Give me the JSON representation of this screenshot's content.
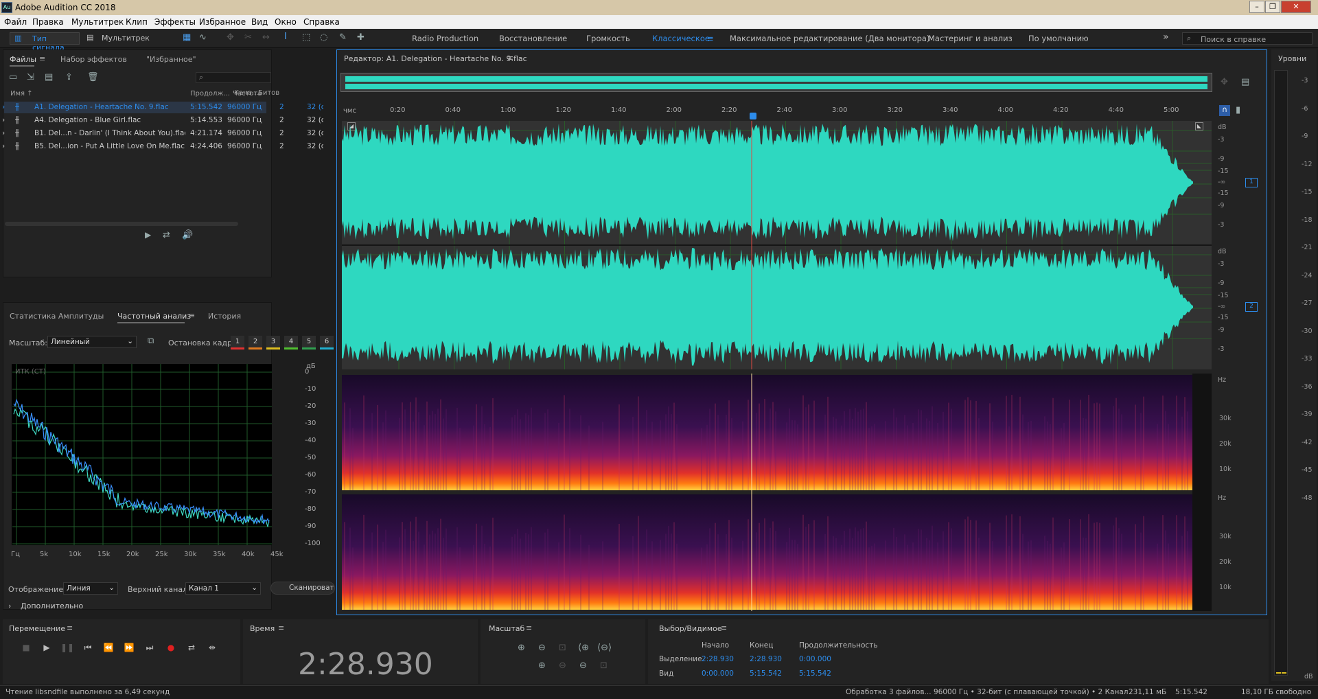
{
  "app": {
    "title": "Adobe Audition CC 2018",
    "icon": "Au"
  },
  "menu": [
    "Файл",
    "Правка",
    "Мультитрек",
    "Клип",
    "Эффекты",
    "Избранное",
    "Вид",
    "Окно",
    "Справка"
  ],
  "toolbar": {
    "mode_waveform": "Тип сигнала",
    "mode_multitrack": "Мультитрек",
    "workspaces": [
      "Radio Production",
      "Восстановление",
      "Громкость",
      "Классическое",
      "Максимальное редактирование (Два монитора)",
      "Мастеринг и анализ",
      "По умолчанию"
    ],
    "active_workspace": "Классическое",
    "more": "»",
    "search_placeholder": "Поиск в справке"
  },
  "files_panel": {
    "tabs": [
      "Файлы",
      "Набор эффектов",
      "\"Избранное\""
    ],
    "search_icon": "⌕",
    "columns": [
      "Имя ↑",
      "Продолж...",
      "Частота",
      "Кана...",
      "Битов"
    ],
    "rows": [
      {
        "name": "A1. Delegation - Heartache No. 9.flac",
        "dur": "5:15.542",
        "rate": "96000 Гц",
        "ch": "2",
        "bits": "32 (с",
        "selected": true
      },
      {
        "name": "A4. Delegation - Blue Girl.flac",
        "dur": "5:14.553",
        "rate": "96000 Гц",
        "ch": "2",
        "bits": "32 (с",
        "selected": false
      },
      {
        "name": "B1. Del...n - Darlin' (I Think About You).flac",
        "dur": "4:21.174",
        "rate": "96000 Гц",
        "ch": "2",
        "bits": "32 (с",
        "selected": false
      },
      {
        "name": "B5. Del...ion - Put A Little Love On Me.flac",
        "dur": "4:24.406",
        "rate": "96000 Гц",
        "ch": "2",
        "bits": "32 (с",
        "selected": false
      }
    ]
  },
  "analysis_panel": {
    "tabs": [
      "Статистика Амплитуды",
      "Частотный анализ",
      "История"
    ],
    "active_tab": "Частотный анализ",
    "scale_label": "Масштаб:",
    "scale_value": "Линейный",
    "freeze_label": "Остановка кадра:",
    "frames": [
      "1",
      "2",
      "3",
      "4",
      "5",
      "6"
    ],
    "frame_colors": [
      "#e03030",
      "#e07a20",
      "#e0c020",
      "#50c030",
      "#30a050",
      "#20b0d0"
    ],
    "plot_label": "ИТК (СТ)",
    "db_unit": "дБ",
    "db_ticks": [
      "0",
      "-10",
      "-20",
      "-30",
      "-40",
      "-50",
      "-60",
      "-70",
      "-80",
      "-90",
      "-100"
    ],
    "freq_ticks": [
      "Гц",
      "5k",
      "10k",
      "15k",
      "20k",
      "25k",
      "30k",
      "35k",
      "40k",
      "45k"
    ],
    "display_label": "Отображение:",
    "display_value": "Линия",
    "channel_label": "Верхний канал:",
    "channel_value": "Канал 1",
    "scan_button": "Сканировать",
    "advanced": "Дополнительно"
  },
  "editor": {
    "title": "Редактор: A1. Delegation - Heartache No. 9.flac",
    "time_unit": "чмс",
    "ruler": [
      "0:20",
      "0:40",
      "1:00",
      "1:20",
      "1:40",
      "2:00",
      "2:20",
      "2:40",
      "3:00",
      "3:20",
      "3:40",
      "4:00",
      "4:20",
      "4:40",
      "5:00"
    ],
    "db_label": "dB",
    "db_scale_top": [
      "-3",
      "-9",
      "-15",
      "-∞",
      "-15",
      "-9",
      "-3"
    ],
    "channels": [
      "1",
      "2"
    ],
    "hz_label": "Hz",
    "hz_ticks": [
      "30k",
      "20k",
      "10k"
    ],
    "playhead_time": "2:28.930",
    "waveform_color": "#2ed8c0"
  },
  "levels": {
    "title": "Уровни",
    "ticks": [
      "-3",
      "-6",
      "-9",
      "-12",
      "-15",
      "-18",
      "-21",
      "-24",
      "-27",
      "-30",
      "-33",
      "-36",
      "-39",
      "-42",
      "-45",
      "-48"
    ],
    "unit": "dB"
  },
  "transport": {
    "title": "Перемещение",
    "buttons": [
      "stop-icon",
      "play-icon",
      "pause-icon",
      "go-start-icon",
      "rewind-icon",
      "fast-forward-icon",
      "go-end-icon",
      "record-icon",
      "loop-icon",
      "skip-icon"
    ]
  },
  "time_panel": {
    "title": "Время",
    "value": "2:28.930"
  },
  "zoom_panel": {
    "title": "Масштаб"
  },
  "selection_panel": {
    "title": "Выбор/Видимое",
    "headers": [
      "Начало",
      "Конец",
      "Продолжительность"
    ],
    "rows": [
      {
        "label": "Выделение",
        "start": "2:28.930",
        "end": "2:28.930",
        "dur": "0:00.000"
      },
      {
        "label": "Вид",
        "start": "0:00.000",
        "end": "5:15.542",
        "dur": "5:15.542"
      }
    ]
  },
  "statusbar": {
    "left": "Чтение libsndfile выполнено за 6,49 секунд",
    "processing": "Обработка 3 файлов...",
    "format": "96000 Гц • 32-бит (с плавающей точкой) • 2 Канал",
    "size": "231,11 мБ",
    "duration": "5:15.542",
    "free": "18,10 ГБ свободно"
  }
}
